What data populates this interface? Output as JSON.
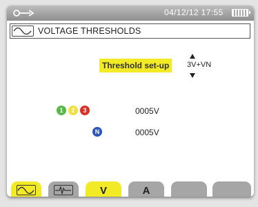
{
  "status": {
    "datetime": "04/12/12 17:55",
    "left_icon": "link-icon",
    "battery_icon": "battery-icon"
  },
  "title": {
    "icon": "waveform-icon",
    "text": "VOLTAGE THRESHOLDS"
  },
  "threshold": {
    "label": "Threshold set-up",
    "selected": "3V+VN"
  },
  "phases": {
    "dots": [
      "1",
      "2",
      "3"
    ],
    "value": "0005V"
  },
  "neutral": {
    "dot": "N",
    "value": "0005V"
  },
  "tabs": {
    "v_label": "V",
    "a_label": "A"
  },
  "colors": {
    "accent_yellow": "#f2ea24",
    "phase1": "#58b947",
    "phase2": "#f2e043",
    "phase3": "#d93127",
    "neutral": "#2a56b6"
  }
}
